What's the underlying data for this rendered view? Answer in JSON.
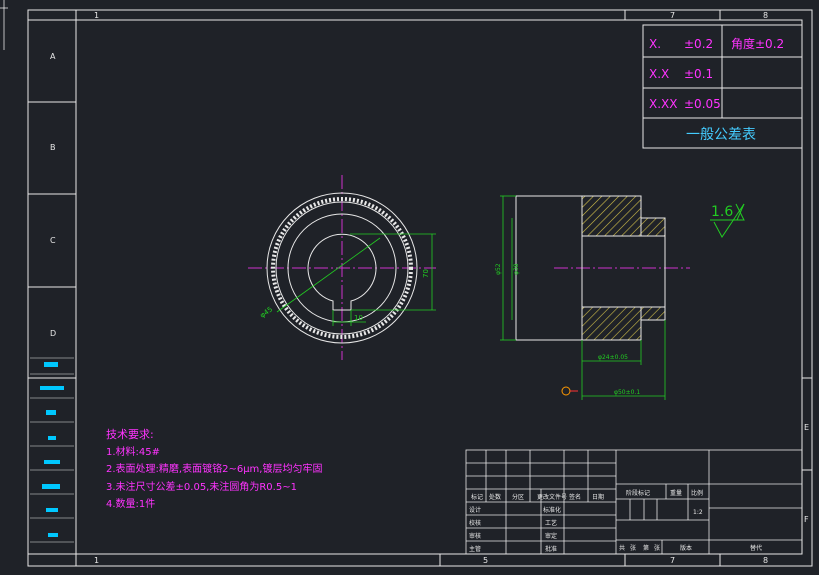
{
  "frame": {
    "col_top": [
      "1",
      "7",
      "8"
    ],
    "col_bottom": [
      "1",
      "5",
      "7",
      "8"
    ],
    "rows_left": [
      "A",
      "B",
      "C",
      "D"
    ],
    "rows_right": [
      "E",
      "F"
    ]
  },
  "tolerance_table": {
    "rows": [
      {
        "format": "X.",
        "tol": "±0.2",
        "extra": "角度±0.2"
      },
      {
        "format": "X.X",
        "tol": "±0.1",
        "extra": ""
      },
      {
        "format": "X.XX",
        "tol": "±0.05",
        "extra": ""
      }
    ],
    "title": "一般公差表"
  },
  "roughness": {
    "value": "1.6"
  },
  "front_view": {
    "dim_diameter": "φ45",
    "dim_height": "70",
    "dim_keyway": "10"
  },
  "side_view": {
    "dim_outer": "φ52",
    "dim_inner": "φ38",
    "dim_hub": "φ24±0.05",
    "dim_length": "φ50±0.1"
  },
  "tech_requirements": {
    "title": "技术要求:",
    "items": [
      "1.材料:45#",
      "2.表面处理:精磨,表面镀铬2~6μm,镀层均匀牢固",
      "3.未注尺寸公差±0.05,未注圆角为R0.5~1",
      "4.数量:1件"
    ]
  },
  "title_block": {
    "header_row": [
      "标记",
      "处数",
      "分区",
      "更改文件号",
      "签名",
      "日期"
    ],
    "left_labels": [
      "设计",
      "校核",
      "审核",
      "主管"
    ],
    "mid_labels": [
      "标准化",
      "工艺",
      "审定",
      "批准"
    ],
    "stage_label": "阶段标记",
    "weight_label": "重量",
    "scale_label": "比例",
    "scale_value": "1:2",
    "bottom_labels": [
      "共",
      "张",
      "第",
      "张"
    ],
    "version_label": "版本",
    "replace_label": "替代"
  },
  "colors": {
    "background": "#1f2228",
    "frame": "#ffffff",
    "text_magenta": "#ff33ff",
    "dimension": "#22cc22",
    "centerline": "#cc33cc",
    "hatch": "#d4c24a",
    "heading_cyan": "#44ccff"
  }
}
